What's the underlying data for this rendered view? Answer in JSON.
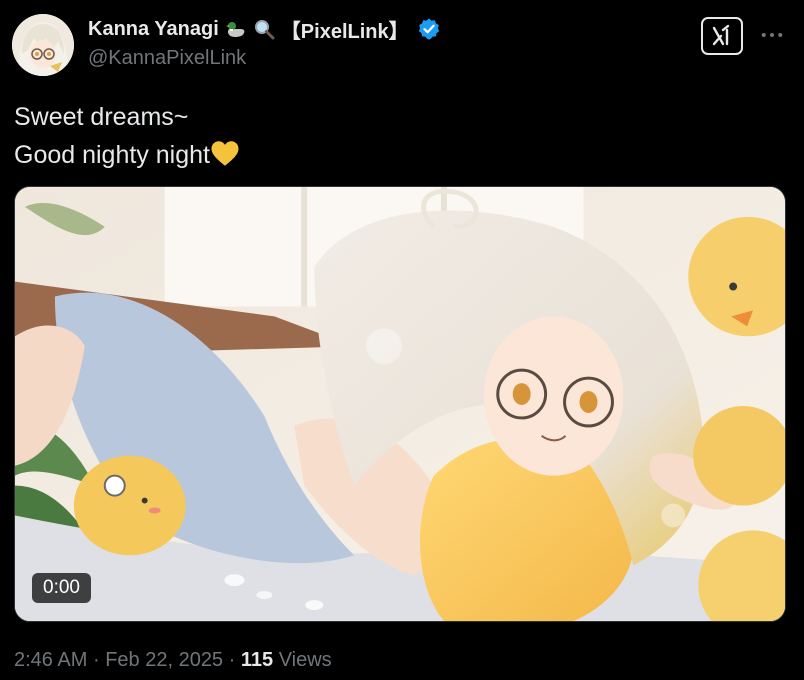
{
  "author": {
    "display_name": "Kanna Yanagi",
    "name_tag": "【PixelLink】",
    "handle": "@KannaPixelLink",
    "name_emojis": [
      "duck-icon",
      "magnifier-icon"
    ],
    "verified": true,
    "verified_color": "#1d9bf0"
  },
  "header_actions": {
    "grok_icon": "grok-icon",
    "more_icon": "more-dots-icon"
  },
  "tweet": {
    "line1": "Sweet dreams~",
    "line2": "Good nighty night",
    "line2_emoji": "yellow-heart-icon"
  },
  "media": {
    "type": "video",
    "duration": "0:00"
  },
  "meta": {
    "time": "2:46 AM",
    "separator": "·",
    "date": "Feb 22, 2025",
    "views_count": "115",
    "views_label": "Views"
  },
  "colors": {
    "background": "#000000",
    "text_primary": "#e7e9ea",
    "text_secondary": "#71767b",
    "accent": "#1d9bf0"
  }
}
